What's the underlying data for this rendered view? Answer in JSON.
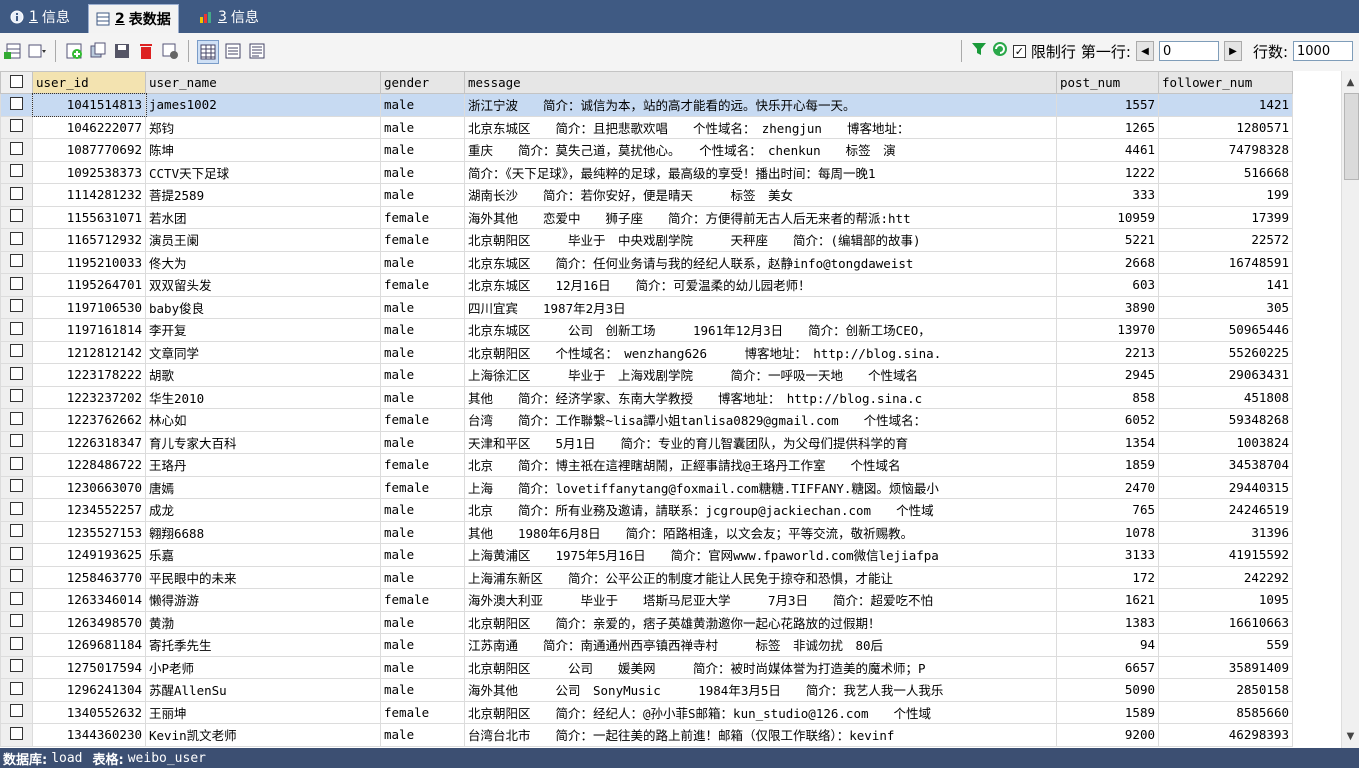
{
  "tabs": [
    {
      "num": "1",
      "label": "信息"
    },
    {
      "num": "2",
      "label": "表数据"
    },
    {
      "num": "3",
      "label": "信息"
    }
  ],
  "toolbar": {
    "limit_label": "限制行",
    "first_row_label": "第一行:",
    "first_row_value": "0",
    "rows_label": "行数:",
    "rows_value": "1000"
  },
  "grid": {
    "columns": [
      "user_id",
      "user_name",
      "gender",
      "message",
      "post_num",
      "follower_num"
    ],
    "rows": [
      [
        "1041514813",
        "james1002",
        "male",
        "浙江宁波　　简介：诚信为本，站的高才能看的远。快乐开心每一天。",
        "1557",
        "1421"
      ],
      [
        "1046222077",
        "郑钧",
        "male",
        "北京东城区　　简介：且把悲歌欢唱　　个性域名：　zhengjun　　博客地址：",
        "1265",
        "1280571"
      ],
      [
        "1087770692",
        "陈坤",
        "male",
        "重庆　　简介：莫失己道，莫扰他心。　　个性域名：　chenkun　　标签　演",
        "4461",
        "74798328"
      ],
      [
        "1092538373",
        "CCTV天下足球",
        "male",
        "简介：《天下足球》，最纯粹的足球，最高级的享受！播出时间：每周一晚1",
        "1222",
        "516668"
      ],
      [
        "1114281232",
        "菩提2589",
        "male",
        "湖南长沙　　简介：若你安好，便是晴天　　　标签　美女",
        "333",
        "199"
      ],
      [
        "1155631071",
        "若水团",
        "female",
        "海外其他　　恋爱中　　狮子座　　简介：方便得前无古人后无来者的帮派:htt",
        "10959",
        "17399"
      ],
      [
        "1165712932",
        "演员王阑",
        "female",
        "北京朝阳区　　　毕业于　中央戏剧学院　　　天秤座　　简介：(编辑部的故事)",
        "5221",
        "22572"
      ],
      [
        "1195210033",
        "佟大为",
        "male",
        "北京东城区　　简介：任何业务请与我的经纪人联系，赵静info@tongdaweist",
        "2668",
        "16748591"
      ],
      [
        "1195264701",
        "双双留头发",
        "female",
        "北京东城区　　12月16日　　简介：可爱温柔的幼儿园老师！",
        "603",
        "141"
      ],
      [
        "1197106530",
        "baby俊良",
        "male",
        "四川宜宾　　1987年2月3日",
        "3890",
        "305"
      ],
      [
        "1197161814",
        "李开复",
        "male",
        "北京东城区　　　公司　创新工场　　　1961年12月3日　　简介：创新工场CEO，",
        "13970",
        "50965446"
      ],
      [
        "1212812142",
        "文章同学",
        "male",
        "北京朝阳区　　个性域名：　wenzhang626　　　博客地址：　http://blog.sina.",
        "2213",
        "55260225"
      ],
      [
        "1223178222",
        "胡歌",
        "male",
        "上海徐汇区　　　毕业于　上海戏剧学院　　　简介：一呼吸一天地　　个性域名",
        "2945",
        "29063431"
      ],
      [
        "1223237202",
        "华生2010",
        "male",
        "其他　　简介：经济学家、东南大学教授　　博客地址：　http://blog.sina.c",
        "858",
        "451808"
      ],
      [
        "1223762662",
        "林心如",
        "female",
        "台湾　　简介：工作聯繫~lisa譚小姐tanlisa0829@gmail.com　　个性域名：",
        "6052",
        "59348268"
      ],
      [
        "1226318347",
        "育儿专家大百科",
        "male",
        "天津和平区　　5月1日　　简介：专业的育儿智囊团队，为父母们提供科学的育",
        "1354",
        "1003824"
      ],
      [
        "1228486722",
        "王珞丹",
        "female",
        "北京　　简介：博主祇在這裡瞎胡鬧，正經事請找@王珞丹工作室　　个性域名",
        "1859",
        "34538704"
      ],
      [
        "1230663070",
        "唐嫣",
        "female",
        "上海　　简介：lovetiffanytang@foxmail.com糖糖.TIFFANY.糖図。烦恼最小",
        "2470",
        "29440315"
      ],
      [
        "1234552257",
        "成龙",
        "male",
        "北京　　简介：所有业務及邀请，請联系：jcgroup@jackiechan.com　　个性域",
        "765",
        "24246519"
      ],
      [
        "1235527153",
        "翱翔6688",
        "male",
        "其他　　1980年6月8日　　简介：陌路相逢，以文会友；平等交流，敬祈赐教。",
        "1078",
        "31396"
      ],
      [
        "1249193625",
        "乐嘉",
        "male",
        "上海黄浦区　　1975年5月16日　　简介：官网www.fpaworld.com微信lejiafpa",
        "3133",
        "41915592"
      ],
      [
        "1258463770",
        "平民眼中的未来",
        "male",
        "上海浦东新区　　简介：公平公正的制度才能让人民免于掠夺和恐惧，才能让",
        "172",
        "242292"
      ],
      [
        "1263346014",
        "懒得游游",
        "female",
        "海外澳大利亚　　　毕业于　　塔斯马尼亚大学　　　7月3日　　简介：超爱吃不怕",
        "1621",
        "1095"
      ],
      [
        "1263498570",
        "黄渤",
        "male",
        "北京朝阳区　　简介：亲爱的，痞子英雄黄渤邀你一起心花路放的过假期！",
        "1383",
        "16610663"
      ],
      [
        "1269681184",
        "寄托季先生",
        "male",
        "江苏南通　　简介：南通通州西亭镇西禅寺村　　　标签　非诚勿扰　80后",
        "94",
        "559"
      ],
      [
        "1275017594",
        "小P老师",
        "male",
        "北京朝阳区　　　公司　　媛美网　　　简介：被时尚媒体誉为打造美的魔术师；P",
        "6657",
        "35891409"
      ],
      [
        "1296241304",
        "苏醒AllenSu",
        "male",
        "海外其他　　　公司　SonyMusic　　　1984年3月5日　　简介：我艺人我一人我乐",
        "5090",
        "2850158"
      ],
      [
        "1340552632",
        "王丽坤",
        "female",
        "北京朝阳区　　简介：经纪人：@孙小菲S邮箱：kun_studio@126.com　　个性域",
        "1589",
        "8585660"
      ],
      [
        "1344360230",
        "Kevin凯文老师",
        "male",
        "台湾台北市　　简介：一起往美的路上前進！邮箱（仅限工作联络）：kevinf",
        "9200",
        "46298393"
      ]
    ]
  },
  "status": {
    "db_label": "数据库:",
    "db_value": "load",
    "table_label": "表格:",
    "table_value": "weibo_user"
  }
}
